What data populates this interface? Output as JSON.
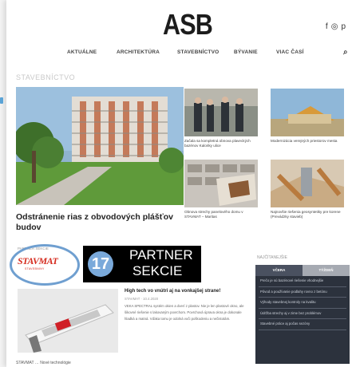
{
  "header": {
    "logo": "ASB",
    "social_icons": [
      "facebook-icon",
      "instagram-icon",
      "pinterest-icon"
    ]
  },
  "nav": {
    "items": [
      "AKTUÁLNE",
      "ARCHITEKTÚRA",
      "STAVEBNÍCTVO",
      "BÝVANIE",
      "VIAC ČASÍ"
    ],
    "search_icon": "search-icon"
  },
  "section": {
    "title": "STAVEBNÍCTVO"
  },
  "hero": {
    "title": "Odstránenie rias z obvodových plášťov budov"
  },
  "cards": [
    {
      "text": "Začala sa kompletná obnova plaveckých bazénov Kaloriky ulice"
    },
    {
      "text": "Modernizácia verejných priestorov mesta"
    },
    {
      "text": "Obnova strechy panelového domu v STAVMAT – Maritas"
    },
    {
      "text": "Najnovšie riešenia geosyntetiky pre korene (Prevádzky stavieb)"
    }
  ],
  "partner": {
    "label": "PARTNER SEKCIE",
    "logo_main": "STAVMAT",
    "logo_sub": "STAVEBNINY",
    "badge": "17",
    "box_line1": "PARTNER",
    "box_line2": "SEKCIE"
  },
  "article": {
    "title": "High tech vo vnútri aj na vonkajšej strane!",
    "meta": "STAVMAT · 10.4.2020",
    "text": "VEKA SPECTRAL systém okien a dverí z plastov. Nie je len plastové okno, ale šikovné riešenie s lakovaným povrchom. Povrchová úprava okna je dokonale hladká a matná. Vďaka tomu je odolná voči poškodeniu a nečistotám."
  },
  "sidebar": {
    "heading": "NAJČÍTANEJŠIE",
    "tabs": [
      "VČERA",
      "TÝŽDEŇ"
    ],
    "items": [
      "Prečo je sú bazénové riešenie vhodnejšie",
      "Pôvod a používanie podlahy rovno z betónu",
      "Výhody stavebnej kontroly na kvalitu",
      "Údržba strechy aj v zime bez problémov",
      "Stavebné práce aj počas sezóny"
    ]
  },
  "bottom": {
    "text": "STAVMAT … Nové technológie"
  },
  "colors": {
    "accent": "#6f9fd0",
    "brand_red": "#d52b1e",
    "sidebar_bg": "#2c323d"
  }
}
